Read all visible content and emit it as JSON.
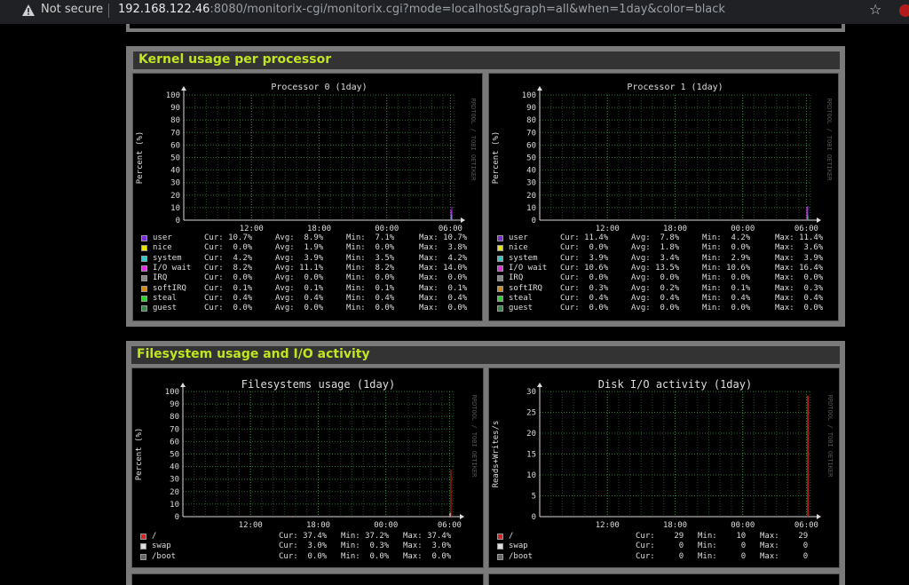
{
  "browser": {
    "security_label": "Not secure",
    "url_host": "192.168.122.46",
    "url_rest": ":8080/monitorix-cgi/monitorix.cgi?mode=localhost&graph=all&when=1day&color=black"
  },
  "colors": {
    "section_title": "#bfe61f",
    "grid": "#2f6b2f",
    "axis_text": "#dddddd",
    "panel_bg": "#000000"
  },
  "sections": [
    {
      "title": "Kernel usage per processor",
      "graphs": [
        {
          "title": "Processor 0  (1day)",
          "ylabel": "Percent (%)",
          "side_label": "RRDTOOL / TOBI OETIKER",
          "yticks": [
            "100",
            "90",
            "80",
            "70",
            "60",
            "50",
            "40",
            "30",
            "20",
            "10",
            "0"
          ],
          "xticks": [
            "12:00",
            "18:00",
            "00:00",
            "06:00"
          ],
          "legend_header": [
            "",
            "Cur:",
            "Avg:",
            "Min:",
            "Max:"
          ],
          "legend": [
            {
              "name": "user",
              "color": "#7b2fd6",
              "cur": "10.7%",
              "avg": "8.9%",
              "min": "7.1%",
              "max": "10.7%"
            },
            {
              "name": "nice",
              "color": "#e6e600",
              "cur": "0.0%",
              "avg": "1.9%",
              "min": "0.0%",
              "max": "3.8%"
            },
            {
              "name": "system",
              "color": "#35c6c6",
              "cur": "4.2%",
              "avg": "3.9%",
              "min": "3.5%",
              "max": "4.2%"
            },
            {
              "name": "I/O wait",
              "color": "#e030e0",
              "cur": "8.2%",
              "avg": "11.1%",
              "min": "8.2%",
              "max": "14.0%"
            },
            {
              "name": "IRQ",
              "color": "#888888",
              "cur": "0.0%",
              "avg": "0.0%",
              "min": "0.0%",
              "max": "0.0%"
            },
            {
              "name": "softIRQ",
              "color": "#d08a1a",
              "cur": "0.1%",
              "avg": "0.1%",
              "min": "0.1%",
              "max": "0.1%"
            },
            {
              "name": "steal",
              "color": "#2ed12e",
              "cur": "0.4%",
              "avg": "0.4%",
              "min": "0.4%",
              "max": "0.4%"
            },
            {
              "name": "guest",
              "color": "#3a8a4a",
              "cur": "0.0%",
              "avg": "0.0%",
              "min": "0.0%",
              "max": "0.0%"
            }
          ]
        },
        {
          "title": "Processor 1  (1day)",
          "ylabel": "Percent (%)",
          "side_label": "RRDTOOL / TOBI OETIKER",
          "yticks": [
            "100",
            "90",
            "80",
            "70",
            "60",
            "50",
            "40",
            "30",
            "20",
            "10",
            "0"
          ],
          "xticks": [
            "12:00",
            "18:00",
            "00:00",
            "06:00"
          ],
          "legend_header": [
            "",
            "Cur:",
            "Avg:",
            "Min:",
            "Max:"
          ],
          "legend": [
            {
              "name": "user",
              "color": "#7b2fd6",
              "cur": "11.4%",
              "avg": "7.8%",
              "min": "4.2%",
              "max": "11.4%"
            },
            {
              "name": "nice",
              "color": "#e6e600",
              "cur": "0.0%",
              "avg": "1.8%",
              "min": "0.0%",
              "max": "3.6%"
            },
            {
              "name": "system",
              "color": "#35c6c6",
              "cur": "3.9%",
              "avg": "3.4%",
              "min": "2.9%",
              "max": "3.9%"
            },
            {
              "name": "I/O wait",
              "color": "#e030e0",
              "cur": "10.6%",
              "avg": "13.5%",
              "min": "10.6%",
              "max": "16.4%"
            },
            {
              "name": "IRQ",
              "color": "#888888",
              "cur": "0.0%",
              "avg": "0.0%",
              "min": "0.0%",
              "max": "0.0%"
            },
            {
              "name": "softIRQ",
              "color": "#d08a1a",
              "cur": "0.3%",
              "avg": "0.2%",
              "min": "0.1%",
              "max": "0.3%"
            },
            {
              "name": "steal",
              "color": "#2ed12e",
              "cur": "0.4%",
              "avg": "0.4%",
              "min": "0.4%",
              "max": "0.4%"
            },
            {
              "name": "guest",
              "color": "#3a8a4a",
              "cur": "0.0%",
              "avg": "0.0%",
              "min": "0.0%",
              "max": "0.0%"
            }
          ]
        }
      ]
    },
    {
      "title": "Filesystem usage and I/O activity",
      "graphs": [
        {
          "title": "Filesystems usage  (1day)",
          "ylabel": "Percent (%)",
          "side_label": "RRDTOOL / TOBI OETIKER",
          "yticks": [
            "100",
            "90",
            "80",
            "70",
            "60",
            "50",
            "40",
            "30",
            "20",
            "10",
            "0"
          ],
          "xticks": [
            "12:00",
            "18:00",
            "00:00",
            "06:00"
          ],
          "legend_header": [
            "",
            "Cur:",
            "Min:",
            "Max:"
          ],
          "legend": [
            {
              "name": "/",
              "color": "#e02020",
              "cur": "37.4%",
              "min": "37.2%",
              "max": "37.4%"
            },
            {
              "name": "swap",
              "color": "#dddddd",
              "cur": "3.0%",
              "min": "0.3%",
              "max": "3.0%"
            },
            {
              "name": "/boot",
              "color": "#666666",
              "cur": "0.0%",
              "min": "0.0%",
              "max": "0.0%"
            }
          ]
        },
        {
          "title": "Disk I/O activity  (1day)",
          "ylabel": "Reads+Writes/s",
          "side_label": "RRDTOOL / TOBI OETIKER",
          "yticks": [
            "30",
            "25",
            "20",
            "15",
            "10",
            "5",
            "0"
          ],
          "xticks": [
            "12:00",
            "18:00",
            "00:00",
            "06:00"
          ],
          "legend_header": [
            "",
            "Cur:",
            "Min:",
            "Max:"
          ],
          "legend": [
            {
              "name": "/",
              "color": "#e02020",
              "cur": "29",
              "min": "10",
              "max": "29"
            },
            {
              "name": "swap",
              "color": "#dddddd",
              "cur": "0",
              "min": "0",
              "max": "0"
            },
            {
              "name": "/boot",
              "color": "#666666",
              "cur": "0",
              "min": "0",
              "max": "0"
            }
          ]
        }
      ]
    }
  ]
}
